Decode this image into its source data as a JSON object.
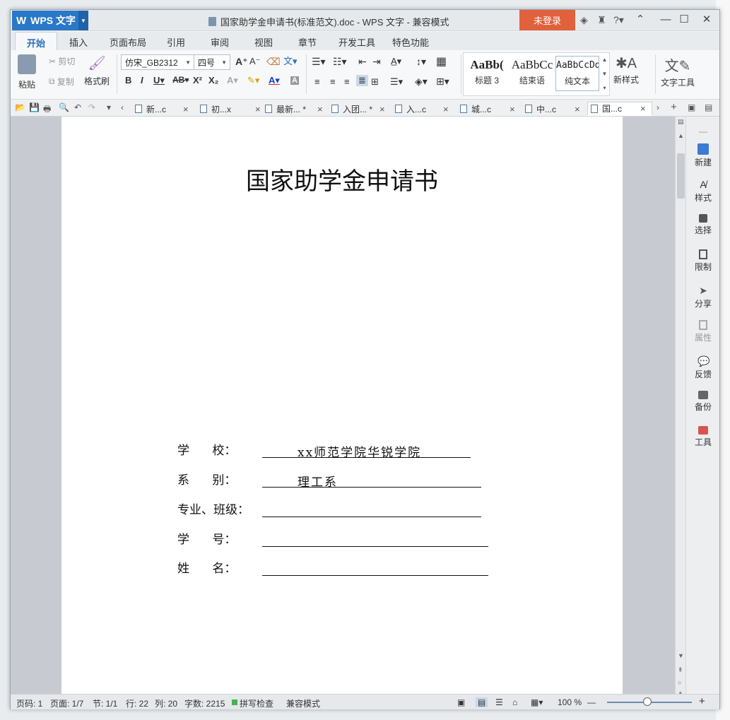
{
  "app": {
    "name": "WPS 文字",
    "login": "未登录"
  },
  "window": {
    "title": "国家助学金申请书(标准范文).doc - WPS 文字 - 兼容模式"
  },
  "ribbon_tabs": [
    "开始",
    "插入",
    "页面布局",
    "引用",
    "审阅",
    "视图",
    "章节",
    "开发工具",
    "特色功能"
  ],
  "ribbon": {
    "paste": "粘贴",
    "cut": "剪切",
    "copy": "复制",
    "format_painter": "格式刷",
    "font_name": "仿宋_GB2312",
    "font_size": "四号",
    "styles": [
      {
        "preview": "AaBb(",
        "label": "标题 3"
      },
      {
        "preview": "AaBbCc",
        "label": "结束语"
      },
      {
        "preview": "AaBbCcDd",
        "label": "纯文本"
      }
    ],
    "new_style": "新样式",
    "text_tools": "文字工具"
  },
  "doc_tabs": [
    "新...c",
    "初...x",
    "最新... *",
    "入团... *",
    "入...c",
    "城...c",
    "中...c",
    "国...c"
  ],
  "document": {
    "title": "国家助学金申请书",
    "fields": [
      {
        "label": "学      校：",
        "value": "xx师范学院华锐学院"
      },
      {
        "label": "系      别：",
        "value": "理工系"
      },
      {
        "label": "专业、班级：",
        "value": ""
      },
      {
        "label": "学      号：",
        "value": ""
      },
      {
        "label": "姓      名：",
        "value": ""
      }
    ]
  },
  "right_panel": [
    "新建",
    "样式",
    "选择",
    "限制",
    "分享",
    "属性",
    "反馈",
    "备份",
    "工具"
  ],
  "status": {
    "page": "页码: 1",
    "pages": "页面: 1/7",
    "section": "节: 1/1",
    "row": "行: 22",
    "col": "列: 20",
    "words": "字数: 2215",
    "spell": "拼写检查",
    "compat": "兼容模式",
    "zoom": "100 %"
  }
}
